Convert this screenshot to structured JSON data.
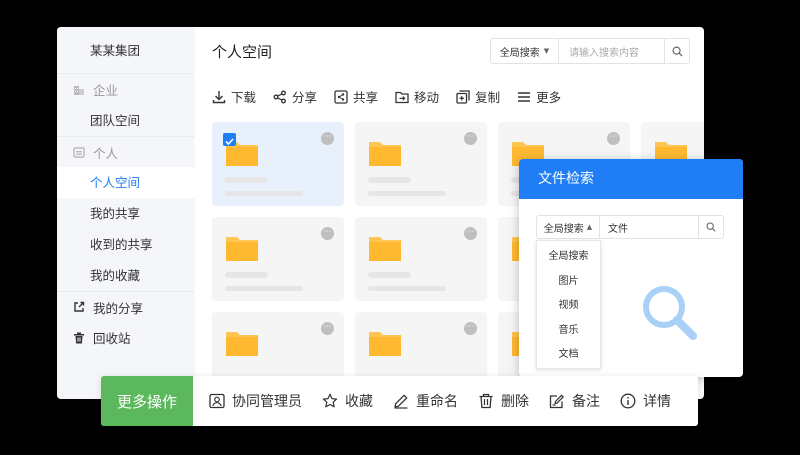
{
  "sidebar": {
    "org": "某某集团",
    "sections": [
      {
        "label": "企业",
        "items": [
          "团队空间"
        ]
      },
      {
        "label": "个人",
        "items": [
          "个人空间",
          "我的共享",
          "收到的共享",
          "我的收藏"
        ]
      }
    ],
    "my_share": "我的分享",
    "recycle": "回收站"
  },
  "header": {
    "title": "个人空间",
    "scope": "全局搜索",
    "placeholder": "请输入搜索内容"
  },
  "toolbar": [
    "下载",
    "分享",
    "共享",
    "移动",
    "复制",
    "更多"
  ],
  "popup": {
    "title": "文件检索",
    "scope": "全局搜索",
    "query": "文件",
    "options": [
      "全局搜索",
      "图片",
      "视频",
      "音乐",
      "文档"
    ]
  },
  "actionbar": {
    "more": "更多操作",
    "items": [
      "协同管理员",
      "收藏",
      "重命名",
      "删除",
      "备注",
      "详情"
    ]
  },
  "colors": {
    "accent": "#1f7ef5",
    "green": "#5cb85c",
    "folder": "#ffc553"
  }
}
